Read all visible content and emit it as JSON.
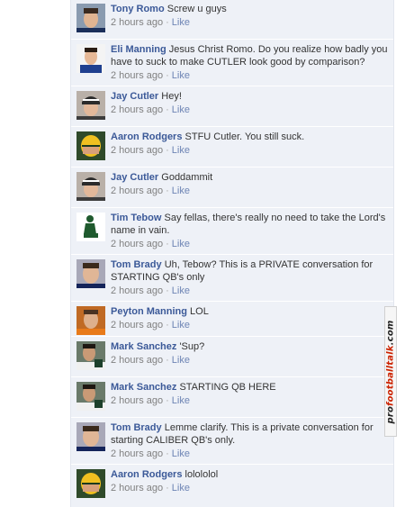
{
  "comments": [
    {
      "author": "Tony Romo",
      "text": "Screw u guys",
      "time": "2 hours ago",
      "like": "Like",
      "avatar": "romo-avatar"
    },
    {
      "author": "Eli Manning",
      "text": "Jesus Christ Romo. Do you realize how badly you have to suck to make CUTLER look good by comparison?",
      "time": "2 hours ago",
      "like": "Like",
      "avatar": "eli-avatar"
    },
    {
      "author": "Jay Cutler",
      "text": "Hey!",
      "time": "2 hours ago",
      "like": "Like",
      "avatar": "cutler-avatar"
    },
    {
      "author": "Aaron Rodgers",
      "text": "STFU Cutler. You still suck.",
      "time": "2 hours ago",
      "like": "Like",
      "avatar": "rodgers-avatar"
    },
    {
      "author": "Jay Cutler",
      "text": "Goddammit",
      "time": "2 hours ago",
      "like": "Like",
      "avatar": "cutler-avatar"
    },
    {
      "author": "Tim Tebow",
      "text": "Say fellas, there's really no need to take the Lord's name in vain.",
      "time": "2 hours ago",
      "like": "Like",
      "avatar": "tebow-avatar"
    },
    {
      "author": "Tom Brady",
      "text": "Uh, Tebow? This is a PRIVATE conversation for STARTING QB's only",
      "time": "2 hours ago",
      "like": "Like",
      "avatar": "brady-avatar"
    },
    {
      "author": "Peyton Manning",
      "text": "LOL",
      "time": "2 hours ago",
      "like": "Like",
      "avatar": "peyton-avatar"
    },
    {
      "author": "Mark Sanchez",
      "text": "'Sup?",
      "time": "2 hours ago",
      "like": "Like",
      "avatar": "sanchez-avatar"
    },
    {
      "author": "Mark Sanchez",
      "text": "STARTING QB HERE",
      "time": "2 hours ago",
      "like": "Like",
      "avatar": "sanchez-avatar"
    },
    {
      "author": "Tom Brady",
      "text": "Lemme clarify. This is a private conversation for starting CALIBER QB's only.",
      "time": "2 hours ago",
      "like": "Like",
      "avatar": "brady-avatar"
    },
    {
      "author": "Aaron Rodgers",
      "text": "lolololol",
      "time": "2 hours ago",
      "like": "Like",
      "avatar": "rodgers-avatar"
    }
  ],
  "watermark": {
    "part1": "pro",
    "part2": "footballtalk",
    "part3": ".com"
  },
  "colors": {
    "thread_bg": "#eef1f7",
    "author_link": "#3b5998",
    "like_link": "#6d84b4",
    "timestamp": "#808080",
    "watermark_accent": "#cc2200"
  }
}
